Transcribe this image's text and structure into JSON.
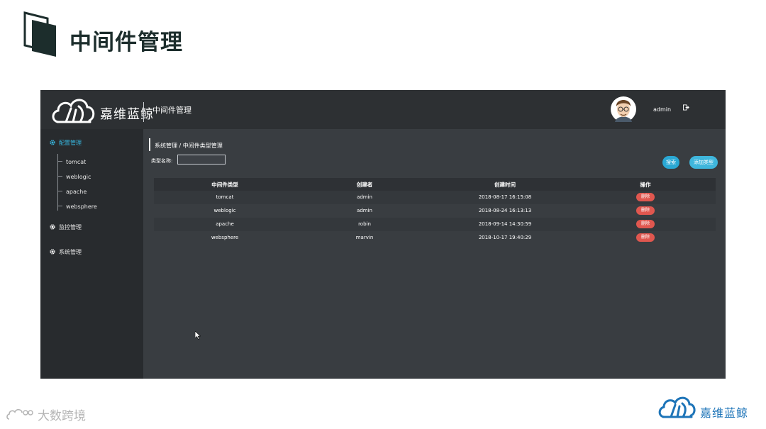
{
  "slide": {
    "title": "中间件管理",
    "footer_brand": "大数跨境",
    "footer_logo_text": "嘉维蓝鲸"
  },
  "app": {
    "brand_name": "嘉维蓝鲸",
    "header_title": "中间件管理",
    "username": "admin",
    "logout_icon": "logout-icon"
  },
  "sidebar": {
    "groups": [
      {
        "label": "配置管理",
        "icon": "gear-icon",
        "active": true,
        "items": [
          "tomcat",
          "weblogic",
          "apache",
          "websphere"
        ]
      },
      {
        "label": "监控管理",
        "icon": "gear-icon",
        "active": false
      },
      {
        "label": "系统管理",
        "icon": "gear-icon",
        "active": false
      }
    ]
  },
  "main": {
    "breadcrumb": "系统管理 / 中间件类型管理",
    "type_label": "类型名称:",
    "type_input_value": "",
    "search_label": "搜索",
    "add_label": "添加类型",
    "table": {
      "headers": [
        "中间件类型",
        "创建者",
        "创建时间",
        "操作"
      ],
      "rows": [
        {
          "type": "tomcat",
          "creator": "admin",
          "time": "2018-08-17 16:15:08",
          "action": "删除"
        },
        {
          "type": "weblogic",
          "creator": "admin",
          "time": "2018-08-24 16:13:13",
          "action": "删除"
        },
        {
          "type": "apache",
          "creator": "robin",
          "time": "2018-09-14 14:30:59",
          "action": "删除"
        },
        {
          "type": "websphere",
          "creator": "marvin",
          "time": "2018-10-17 19:40:29",
          "action": "删除"
        }
      ]
    }
  },
  "colors": {
    "accent": "#2aa8d4",
    "danger": "#e0574f",
    "sidebar_active": "#37b6de",
    "panel": "#393d41",
    "topbar": "#2d3033"
  }
}
